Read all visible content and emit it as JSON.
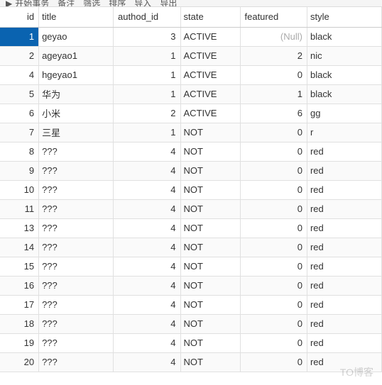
{
  "toolbar": {
    "btn1": "开始事务",
    "btn2": "备注",
    "btn3": "筛选",
    "btn4": "排序",
    "btn5": "导入",
    "btn6": "导出"
  },
  "columns": {
    "id": "id",
    "title": "title",
    "authod_id": "authod_id",
    "state": "state",
    "featured": "featured",
    "style": "style"
  },
  "null_label": "(Null)",
  "rows": [
    {
      "id": "1",
      "title": "geyao",
      "authod_id": "3",
      "state": "ACTIVE",
      "featured": null,
      "style": "black",
      "selected": true
    },
    {
      "id": "2",
      "title": "ageyao1",
      "authod_id": "1",
      "state": "ACTIVE",
      "featured": "2",
      "style": "nic"
    },
    {
      "id": "4",
      "title": "hgeyao1",
      "authod_id": "1",
      "state": "ACTIVE",
      "featured": "0",
      "style": "black"
    },
    {
      "id": "5",
      "title": "华为",
      "authod_id": "1",
      "state": "ACTIVE",
      "featured": "1",
      "style": "black"
    },
    {
      "id": "6",
      "title": "小米",
      "authod_id": "2",
      "state": "ACTIVE",
      "featured": "6",
      "style": "gg"
    },
    {
      "id": "7",
      "title": "三星",
      "authod_id": "1",
      "state": "NOT",
      "featured": "0",
      "style": "r"
    },
    {
      "id": "8",
      "title": "???",
      "authod_id": "4",
      "state": "NOT",
      "featured": "0",
      "style": "red"
    },
    {
      "id": "9",
      "title": "???",
      "authod_id": "4",
      "state": "NOT",
      "featured": "0",
      "style": "red"
    },
    {
      "id": "10",
      "title": "???",
      "authod_id": "4",
      "state": "NOT",
      "featured": "0",
      "style": "red"
    },
    {
      "id": "11",
      "title": "???",
      "authod_id": "4",
      "state": "NOT",
      "featured": "0",
      "style": "red"
    },
    {
      "id": "13",
      "title": "???",
      "authod_id": "4",
      "state": "NOT",
      "featured": "0",
      "style": "red"
    },
    {
      "id": "14",
      "title": "???",
      "authod_id": "4",
      "state": "NOT",
      "featured": "0",
      "style": "red"
    },
    {
      "id": "15",
      "title": "???",
      "authod_id": "4",
      "state": "NOT",
      "featured": "0",
      "style": "red"
    },
    {
      "id": "16",
      "title": "???",
      "authod_id": "4",
      "state": "NOT",
      "featured": "0",
      "style": "red"
    },
    {
      "id": "17",
      "title": "???",
      "authod_id": "4",
      "state": "NOT",
      "featured": "0",
      "style": "red"
    },
    {
      "id": "18",
      "title": "???",
      "authod_id": "4",
      "state": "NOT",
      "featured": "0",
      "style": "red"
    },
    {
      "id": "19",
      "title": "???",
      "authod_id": "4",
      "state": "NOT",
      "featured": "0",
      "style": "red"
    },
    {
      "id": "20",
      "title": "???",
      "authod_id": "4",
      "state": "NOT",
      "featured": "0",
      "style": "red"
    }
  ],
  "watermark": "TO博客"
}
